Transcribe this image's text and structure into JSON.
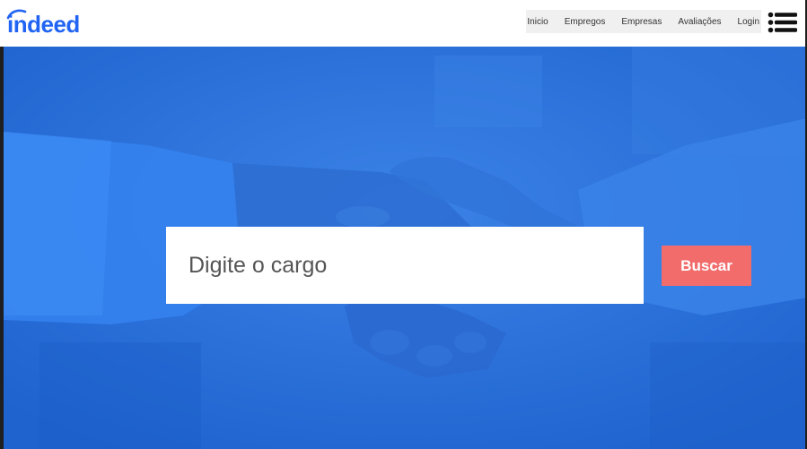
{
  "brand": {
    "logo_text": "indeed",
    "logo_color": "#2164f3"
  },
  "nav": {
    "items": [
      {
        "label": "Inicio"
      },
      {
        "label": "Empregos"
      },
      {
        "label": "Empresas"
      },
      {
        "label": "Avaliações"
      },
      {
        "label": "Login"
      }
    ],
    "menu_icon": "hamburger-menu-icon"
  },
  "hero": {
    "background_color": "#2e73db",
    "image_subject": "handshake-photo",
    "search": {
      "placeholder": "Digite o cargo",
      "value": ""
    },
    "search_button_label": "Buscar",
    "search_button_color": "#f26c6c"
  }
}
